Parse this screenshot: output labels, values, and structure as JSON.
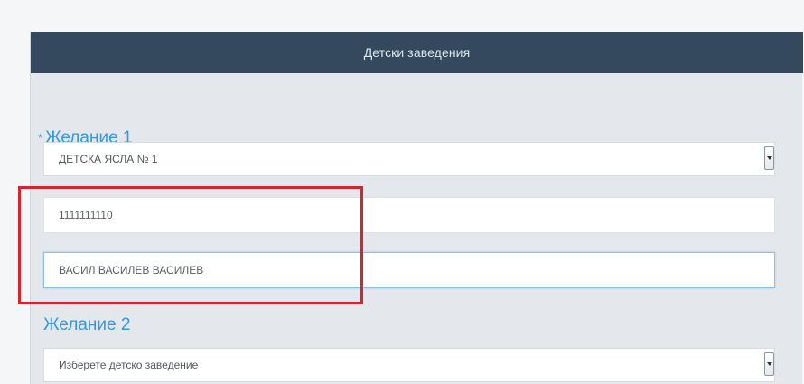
{
  "panel": {
    "header_title": "Детски заведения"
  },
  "wish1": {
    "title": "Желание 1",
    "required_mark": "*",
    "select_value": "ДЕТСКА ЯСЛА № 1",
    "input_id_value": "1111111110",
    "input_name_value": "ВАСИЛ ВАСИЛЕВ ВАСИЛЕВ"
  },
  "wish2": {
    "title": "Желание 2",
    "select_value": "Изберете детско заведение"
  },
  "icons": {
    "select_arrow": "chevron-down-icon"
  },
  "colors": {
    "header_bg": "#34495e",
    "panel_bg": "#e4e8ed",
    "title_color": "#3498db",
    "highlight": "#d3262f"
  }
}
